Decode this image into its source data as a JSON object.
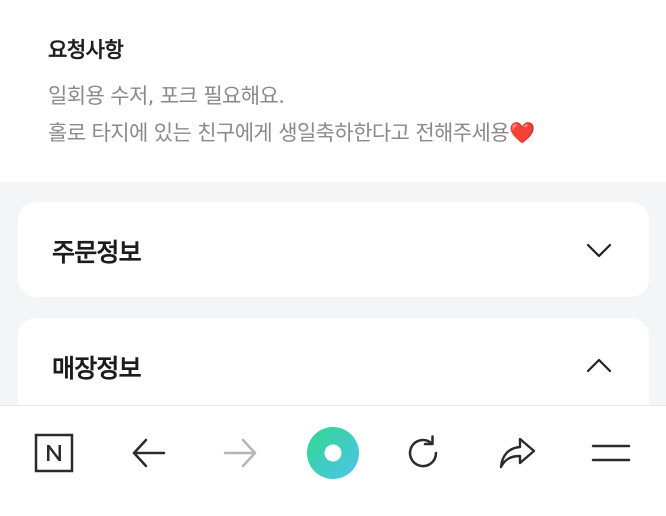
{
  "request": {
    "title": "요청사항",
    "line1": "일회용 수저, 포크 필요해요.",
    "line2_text": "홀로 타지에 있는 친구에게 생일축하한다고 전해주세용",
    "line2_emoji": "❤️"
  },
  "order_info": {
    "title": "주문정보",
    "chevron": "chevron-down-icon"
  },
  "store_info": {
    "title": "매장정보",
    "chevron": "chevron-up-icon"
  },
  "bottom_bar": {
    "icons": [
      "naver-n-icon",
      "back-arrow-icon",
      "forward-arrow-icon",
      "green-dot-icon",
      "refresh-icon",
      "share-icon",
      "menu-icon"
    ],
    "accent_green": "#2fd88a",
    "accent_teal": "#4fc3f0"
  }
}
